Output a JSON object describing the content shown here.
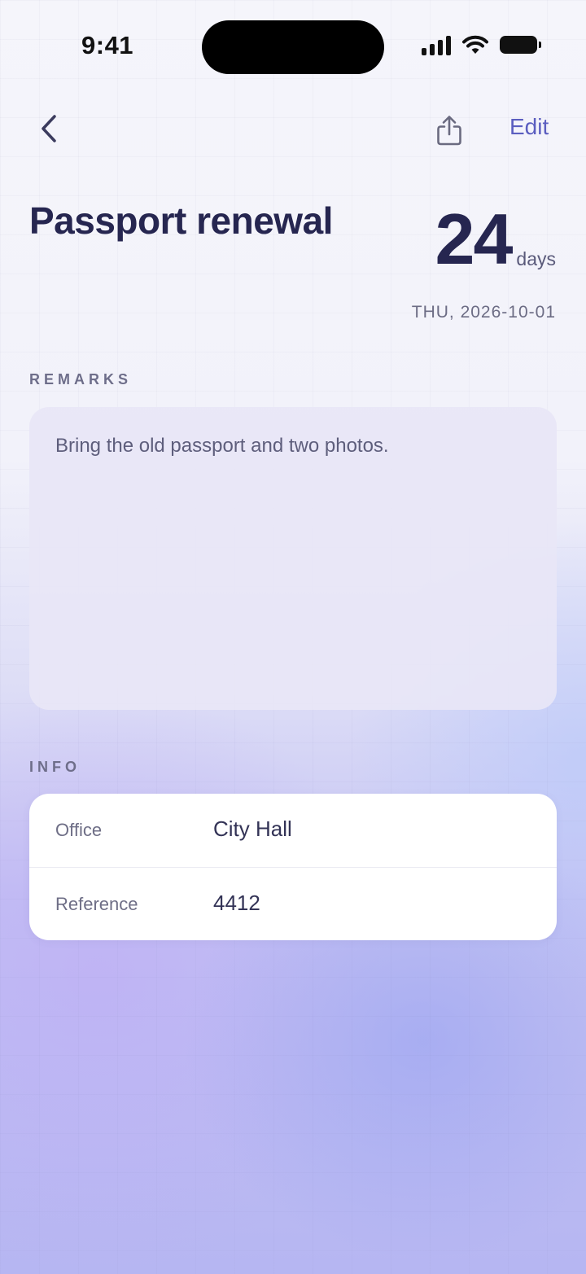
{
  "status_bar": {
    "time": "9:41",
    "icons": [
      "cellular-signal-icon",
      "wifi-icon",
      "battery-icon"
    ]
  },
  "nav": {
    "back_icon": "chevron-left-icon",
    "share_icon": "share-icon",
    "edit_label": "Edit"
  },
  "event": {
    "title": "Passport renewal",
    "countdown_value": "24",
    "countdown_unit": "days",
    "date": "THU, 2026-10-01"
  },
  "remarks": {
    "label": "REMARKS",
    "text": "Bring the old passport and two photos."
  },
  "info": {
    "label": "INFO",
    "rows": [
      {
        "key": "Office",
        "value": "City Hall"
      },
      {
        "key": "Reference",
        "value": "4412"
      }
    ]
  },
  "colors": {
    "accent": "#5b5ec0",
    "title": "#262650",
    "muted": "#6e6e8a"
  }
}
